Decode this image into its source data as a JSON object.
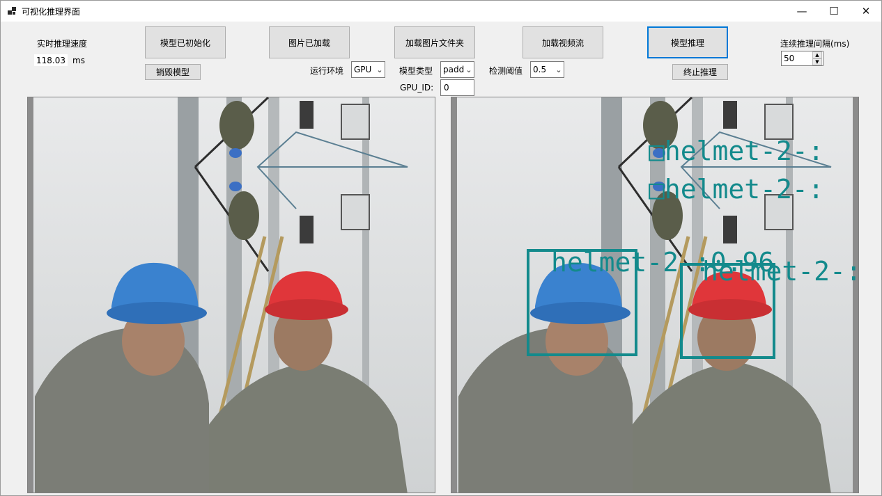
{
  "window": {
    "title": "可视化推理界面",
    "minimize_glyph": "—",
    "maximize_glyph": "☐",
    "close_glyph": "✕"
  },
  "speed": {
    "label": "实时推理速度",
    "value": "118.03",
    "unit": "ms"
  },
  "buttons": {
    "init_model": "模型已初始化",
    "destroy_model": "销毁模型",
    "load_image": "图片已加载",
    "load_folder": "加载图片文件夹",
    "load_video": "加载视频流",
    "infer": "模型推理",
    "stop_infer": "终止推理"
  },
  "settings": {
    "runtime_label": "运行环境",
    "runtime_value": "GPU",
    "model_type_label": "模型类型",
    "model_type_value": "padd",
    "gpu_id_label": "GPU_ID:",
    "gpu_id_value": "0",
    "threshold_label": "检测阈值",
    "threshold_value": "0.5",
    "interval_label": "连续推理间隔(ms)",
    "interval_value": "50"
  },
  "detections": {
    "label_1": "□helmet-2-:",
    "label_2": "□helmet-2-:",
    "label_3": "helmet-2-:0.96",
    "label_4": "helmet-2-:",
    "box_color": "#138a8c"
  },
  "colors": {
    "accent": "#0078d7",
    "button_face": "#e1e1e1",
    "window_bg": "#f0f0f0"
  }
}
